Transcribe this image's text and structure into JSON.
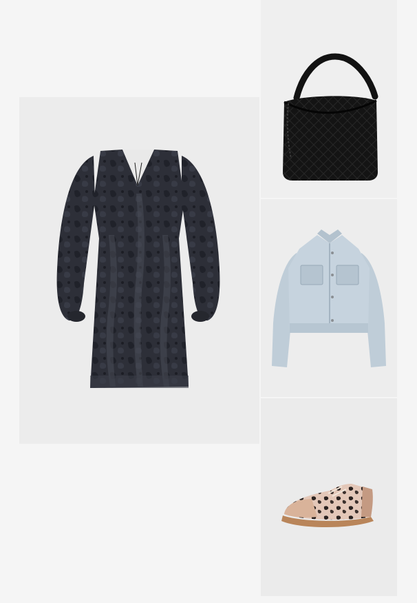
{
  "outfit": {
    "items": [
      {
        "id": "dress",
        "name": "dress-image",
        "category": "dress",
        "color": "#2b2d34"
      },
      {
        "id": "bag",
        "name": "bag-image",
        "category": "bag",
        "color": "#121212"
      },
      {
        "id": "jacket",
        "name": "jacket-image",
        "category": "denim jacket",
        "color": "#c3d0da"
      },
      {
        "id": "shoe",
        "name": "sneaker-image",
        "category": "sneaker",
        "color": "#d9b79a"
      }
    ]
  }
}
